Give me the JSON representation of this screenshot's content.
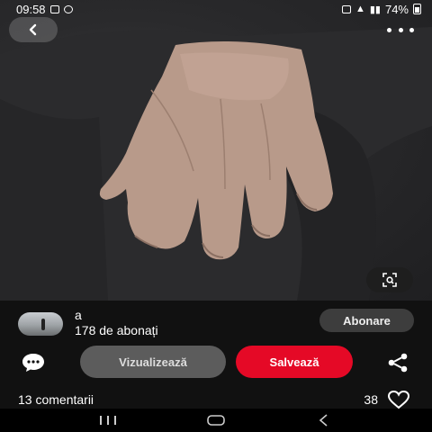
{
  "status_bar": {
    "time": "09:58",
    "battery": "74%"
  },
  "pin": {
    "creator_name": "a",
    "follower_count": "178 de abonați",
    "follow_label": "Abonare",
    "view_label": "Vizualizează",
    "save_label": "Salvează",
    "comments_label": "13 comentarii",
    "likes_count": "38"
  },
  "colors": {
    "save": "#e50926",
    "follow": "#3d3d3d",
    "view": "#5c5c5c"
  },
  "icons": [
    "back-icon",
    "more-icon",
    "visual-search-icon",
    "comment-icon",
    "share-icon",
    "heart-icon"
  ]
}
